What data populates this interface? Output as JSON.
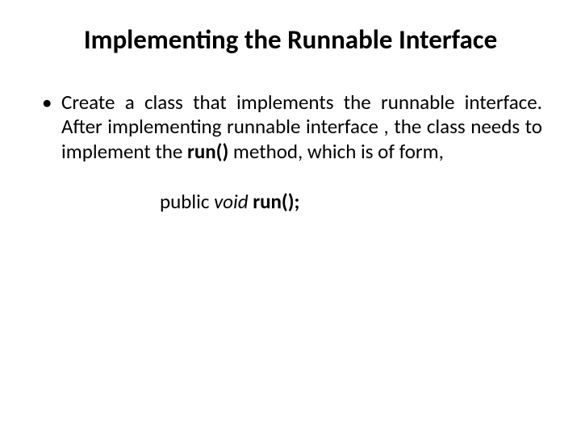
{
  "slide": {
    "title": "Implementing the Runnable Interface",
    "bullet": {
      "pre": "Create a class that implements the runnable interface. After implementing runnable interface , the class needs to implement the ",
      "method": "run()",
      "post": " method, which is of form,"
    },
    "signature": {
      "public": "public ",
      "void": "void ",
      "call": "run();"
    }
  }
}
